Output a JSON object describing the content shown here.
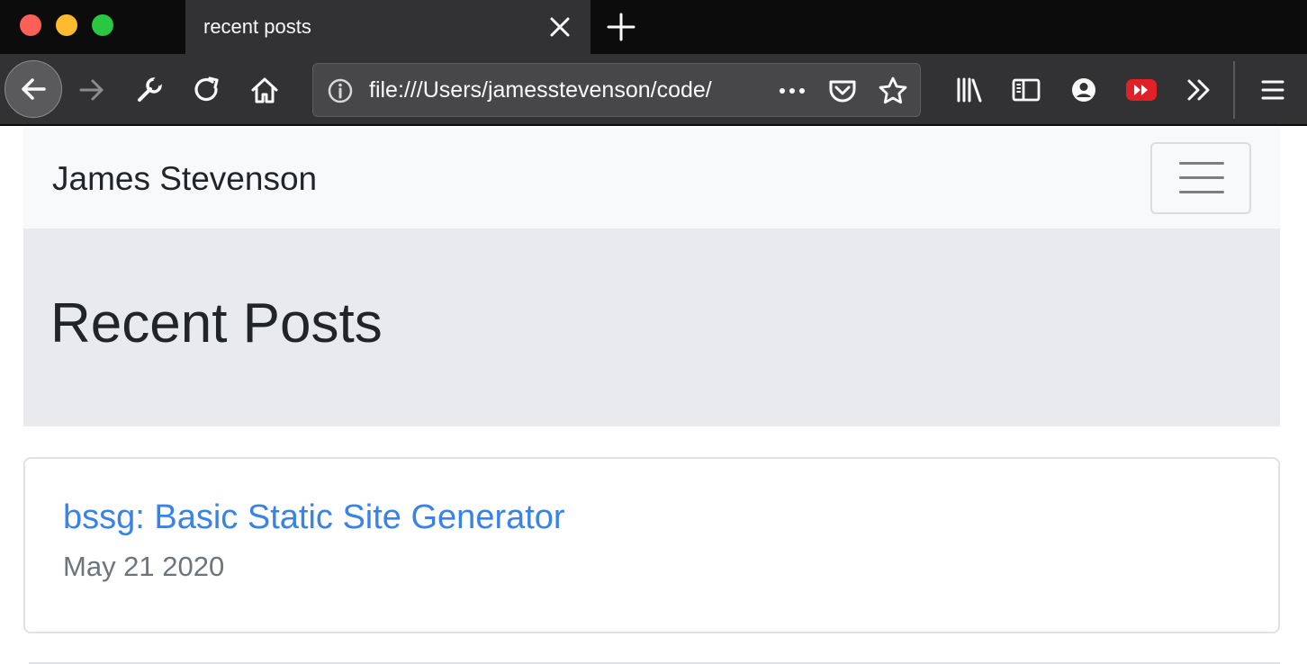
{
  "browser": {
    "tab_title": "recent posts",
    "url": "file:///Users/jamesstevenson/code/",
    "icons": [
      "back-icon",
      "forward-icon",
      "wrench-icon",
      "reload-icon",
      "home-icon",
      "info-icon",
      "more-dots-icon",
      "pocket-icon",
      "star-icon",
      "library-icon",
      "sidebar-icon",
      "account-icon",
      "youtube-icon",
      "overflow-icon",
      "hamburger-menu-icon"
    ],
    "colors": {
      "tabbar": "#0c0c0d",
      "toolbar": "#323234",
      "youtube": "#e22027"
    }
  },
  "site": {
    "brand": "James Stevenson",
    "page_title": "Recent Posts",
    "posts": [
      {
        "title": "bssg: Basic Static Site Generator",
        "date": "May 21 2020"
      }
    ],
    "colors": {
      "link": "#3a82e8",
      "muted": "#6c757d",
      "jumbotron": "#e9eaee",
      "navbar": "#f8f9fa"
    }
  }
}
